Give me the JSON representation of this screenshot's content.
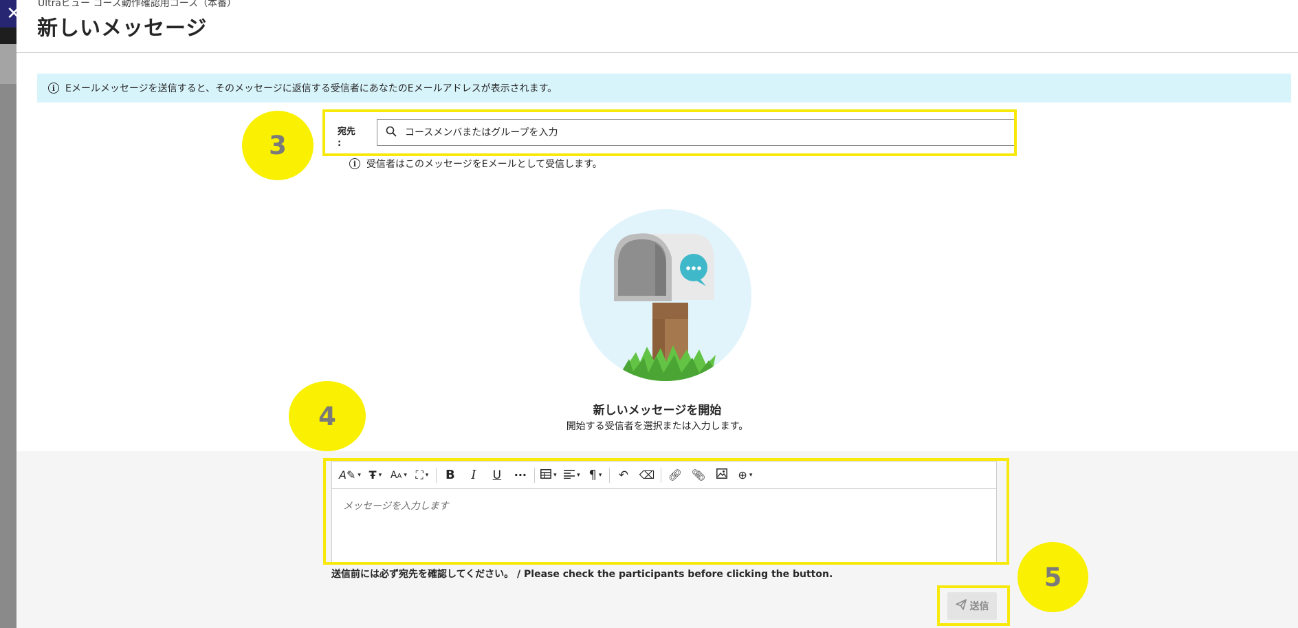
{
  "window": {
    "close_symbol": "✕",
    "breadcrumb": "Ultraビュー コース動作確認用コース（本番）",
    "title": "新しいメッセージ"
  },
  "info_banner": {
    "text": "Eメールメッセージを送信すると、そのメッセージに返信する受信者にあなたのEメールアドレスが表示されます。",
    "icon": "info-icon"
  },
  "recipient": {
    "label": "宛先\n:",
    "placeholder": "コースメンバまたはグループを入力",
    "value": "",
    "hint": "受信者はこのメッセージをEメールとして受信します。"
  },
  "empty_state": {
    "illustration": "mailbox-illustration",
    "title": "新しいメッセージを開始",
    "subtitle": "開始する受信者を選択または入力します。"
  },
  "editor": {
    "placeholder": "メッセージを入力します",
    "toolbar": [
      {
        "name": "text-style",
        "icon": "pen-a-icon",
        "dropdown": true
      },
      {
        "name": "paragraph-format",
        "icon": "format-t-icon",
        "dropdown": true
      },
      {
        "name": "font-size",
        "icon": "font-size-icon",
        "dropdown": true
      },
      {
        "name": "text-color",
        "icon": "paint-bucket-icon",
        "dropdown": true
      },
      {
        "name": "bold",
        "icon": "bold-icon",
        "dropdown": false
      },
      {
        "name": "italic",
        "icon": "italic-icon",
        "dropdown": false
      },
      {
        "name": "underline",
        "icon": "underline-icon",
        "dropdown": false
      },
      {
        "name": "more-text",
        "icon": "ellipsis-icon",
        "dropdown": false
      },
      {
        "name": "table",
        "icon": "table-icon",
        "dropdown": true
      },
      {
        "name": "align",
        "icon": "align-left-icon",
        "dropdown": true
      },
      {
        "name": "paragraph",
        "icon": "pilcrow-icon",
        "dropdown": true
      },
      {
        "name": "undo",
        "icon": "undo-icon",
        "dropdown": false
      },
      {
        "name": "clear-format",
        "icon": "eraser-icon",
        "dropdown": false
      },
      {
        "name": "link",
        "icon": "link-icon",
        "dropdown": false
      },
      {
        "name": "attach",
        "icon": "paperclip-icon",
        "dropdown": false
      },
      {
        "name": "image",
        "icon": "image-icon",
        "dropdown": false
      },
      {
        "name": "insert",
        "icon": "plus-circle-icon",
        "dropdown": true
      }
    ]
  },
  "notice": "送信前には必ず宛先を確認してください。 / Please check the participants before clicking the button.",
  "send_button": {
    "label": "送信",
    "icon": "paper-plane-icon",
    "disabled": true
  },
  "annotations": {
    "color": "#f7e90c",
    "steps": [
      "3",
      "4",
      "5"
    ]
  },
  "colors": {
    "banner_bg": "#d8f4fb",
    "close_bg": "#262673",
    "compose_bg": "#f5f5f5",
    "highlight": "#f7e90c"
  }
}
